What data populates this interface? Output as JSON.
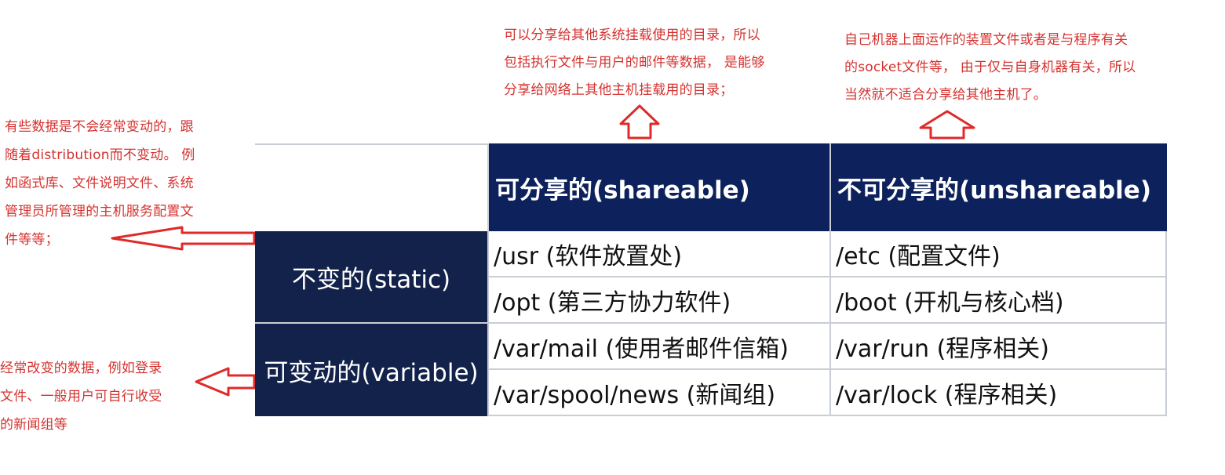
{
  "notes": {
    "left_top": "有些数据是不会经常变动的，跟\n随着distribution而不变动。 例\n如函式库、文件说明文件、系统\n管理员所管理的主机服务配置文\n件等等；",
    "left_bottom": "经常改变的数据，例如登录\n文件、一般用户可自行收受\n的新闻组等",
    "top_middle": "可以分享给其他系统挂载使用的目录，所以\n包括执行文件与用户的邮件等数据， 是能够\n分享给网络上其他主机挂载用的目录；",
    "top_right": "自己机器上面运作的装置文件或者是与程序有关\n的socket文件等， 由于仅与自身机器有关，所以\n当然就不适合分享给其他主机了。"
  },
  "table": {
    "col_headers": [
      "可分享的(shareable)",
      "不可分享的(unshareable)"
    ],
    "row_headers": [
      "不变的(static)",
      "可变动的(variable)"
    ],
    "cells": [
      [
        "/usr (软件放置处)",
        "/etc (配置文件)"
      ],
      [
        "/opt (第三方协力软件)",
        "/boot (开机与核心档)"
      ],
      [
        "/var/mail (使用者邮件信箱)",
        "/var/run (程序相关)"
      ],
      [
        "/var/spool/news (新闻组)",
        "/var/lock (程序相关)"
      ]
    ]
  },
  "colors": {
    "header_bg": "#0d225c",
    "row_header_bg": "#12224a",
    "annotation": "#d4322f"
  },
  "icons": [
    "arrow-up-icon",
    "arrow-up-icon",
    "arrow-left-icon",
    "arrow-left-icon"
  ]
}
